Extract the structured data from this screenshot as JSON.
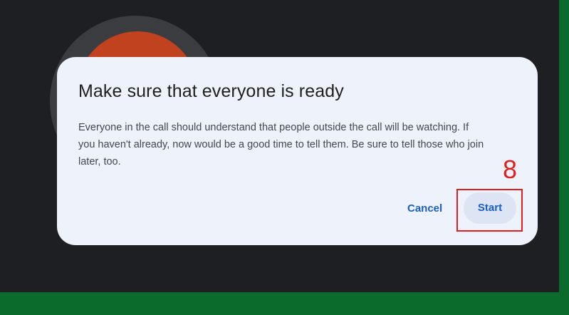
{
  "dialog": {
    "title": "Make sure that everyone is ready",
    "body": "Everyone in the call should understand that people outside the call will be watching. If you haven't already, now would be a good time to tell them. Be sure to tell those who join later, too.",
    "cancel_label": "Cancel",
    "start_label": "Start"
  },
  "annotation": {
    "step_number": "8",
    "color": "#e02020"
  },
  "colors": {
    "stage_background": "#1e1f22",
    "frame_green": "#0b6b2c",
    "avatar": "#c0421f",
    "dialog_background": "#eef2fb",
    "accent_blue": "#1a5fc8"
  }
}
